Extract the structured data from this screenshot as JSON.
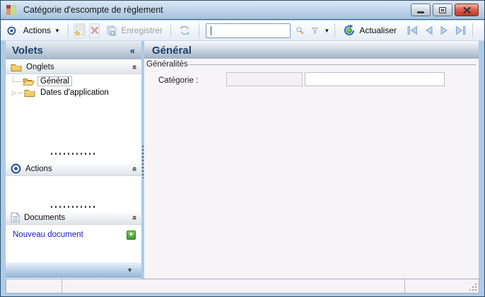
{
  "window": {
    "title": "Catégorie d'escompte de règlement"
  },
  "toolbar": {
    "actions": {
      "label": "Actions",
      "caret": "▼"
    },
    "save_label": "Enregistrer",
    "search": {
      "value": ""
    },
    "filter_caret": "▼",
    "refresh_label": "Actualiser"
  },
  "sidebar": {
    "title": "Volets",
    "collapse_glyph": "«",
    "section_chevron": "»",
    "sections": {
      "onglets": "Onglets",
      "actions": "Actions",
      "documents": "Documents"
    },
    "tree": {
      "expand_glyph": "▷",
      "items": [
        {
          "label": "Général",
          "selected": true
        },
        {
          "label": "Dates d'application",
          "selected": false
        }
      ]
    },
    "new_document": {
      "label": "Nouveau document",
      "add_glyph": "+"
    },
    "bottom_arrow": "▼"
  },
  "main": {
    "title": "Général",
    "group": "Généralités",
    "category": {
      "label": "Catégorie :",
      "value_left": "",
      "value_right": ""
    }
  },
  "statusbar": {
    "cell_left": "",
    "cell_middle": "",
    "cell_right": ""
  },
  "colors": {
    "header_text": "#1c3f6e",
    "titlebar_top": "#dbe8f4",
    "titlebar_bottom": "#a6c2de",
    "close_button_red": "#c03a22",
    "link_blue": "#1717cc",
    "add_button_green": "#3e9b2e",
    "nav_arrow_blue": "#b7d2ef",
    "folder_yellow": "#f2c14e"
  }
}
